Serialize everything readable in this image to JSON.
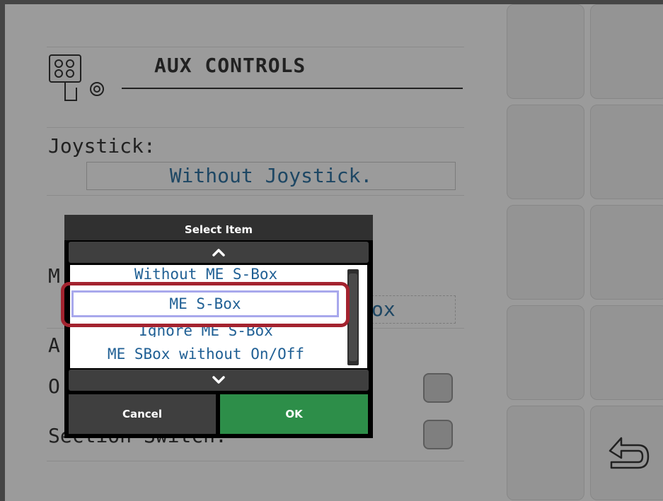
{
  "page": {
    "title": "AUX CONTROLS",
    "joystick_label": "Joystick:",
    "joystick_value": "Without Joystick.",
    "sbox_label_partial": "M",
    "sbox_value_partial": "ox",
    "row3_partial": "A",
    "row4_partial": "O",
    "section_switch_label": "Section Switch:"
  },
  "dialog": {
    "title": "Select Item",
    "items": [
      "Without ME S-Box",
      "ME S-Box",
      "Ignore ME S-Box",
      "ME SBox without On/Off"
    ],
    "selected_index": 1,
    "cancel_label": "Cancel",
    "ok_label": "OK"
  },
  "icons": {
    "scroll_up": "chevron-up-icon",
    "scroll_down": "chevron-down-icon",
    "app": "aux-controls-icon",
    "return": "return-icon"
  },
  "colors": {
    "ok_button": "#2d8e49",
    "highlight": "#a3232f",
    "value_text": "#2f6e9a"
  }
}
